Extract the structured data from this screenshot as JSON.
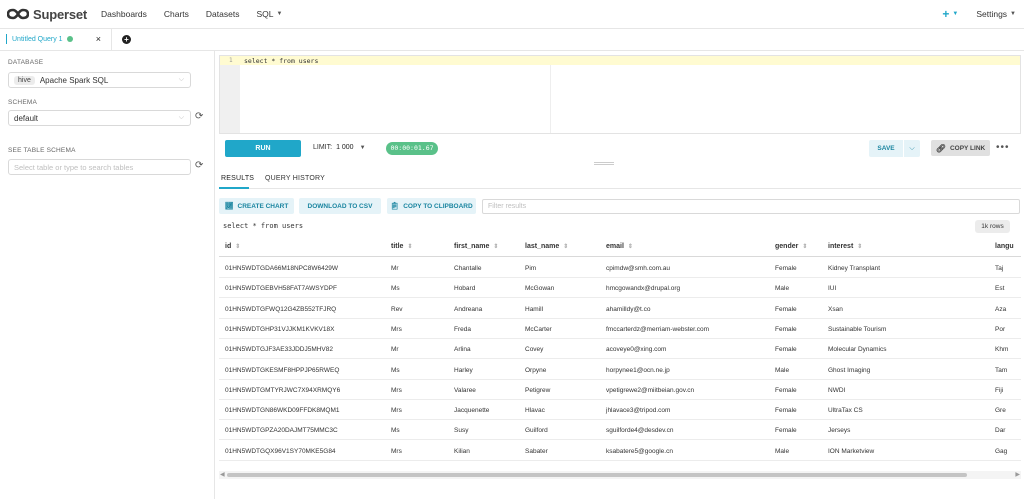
{
  "brand": {
    "name": "Superset"
  },
  "nav": {
    "items": [
      {
        "label": "Dashboards"
      },
      {
        "label": "Charts"
      },
      {
        "label": "Datasets"
      },
      {
        "label": "SQL"
      }
    ],
    "plus": "+",
    "settings": "Settings"
  },
  "tabs": {
    "active_label": "Untitled Query 1",
    "close": "×",
    "add": "+"
  },
  "left": {
    "database_label": "DATABASE",
    "database_tag": "hive",
    "database_value": "Apache Spark SQL",
    "schema_label": "SCHEMA",
    "schema_value": "default",
    "table_label": "SEE TABLE SCHEMA",
    "table_placeholder": "Select table or type to search tables"
  },
  "editor": {
    "line_number": "1",
    "code": "select * from users"
  },
  "toolbar": {
    "run": "RUN",
    "limit_label": "LIMIT:",
    "limit_value": "1 000",
    "timer": "00:00:01.67",
    "save": "SAVE",
    "copy_link": "COPY LINK"
  },
  "results": {
    "tab_results": "RESULTS",
    "tab_history": "QUERY HISTORY",
    "create_chart": "CREATE CHART",
    "download_csv": "DOWNLOAD TO CSV",
    "copy_clipboard": "COPY TO CLIPBOARD",
    "filter_placeholder": "Filter results",
    "query_text": "select * from users",
    "rows_badge": "1k rows",
    "columns": [
      "id",
      "title",
      "first_name",
      "last_name",
      "email",
      "gender",
      "interest",
      "langu"
    ],
    "rows": [
      [
        "01HN5WDTGDA66M18NPC8W6429W",
        "Mr",
        "Chantalle",
        "Pim",
        "cpimdw@smh.com.au",
        "Female",
        "Kidney Transplant",
        "Taj"
      ],
      [
        "01HN5WDTGEBVH58FAT7AWSYDPF",
        "Ms",
        "Hobard",
        "McGowan",
        "hmcgowandx@drupal.org",
        "Male",
        "IUI",
        "Est"
      ],
      [
        "01HN5WDTGFWQ12G4ZB552TFJRQ",
        "Rev",
        "Andreana",
        "Hamill",
        "ahamilldy@t.co",
        "Female",
        "Xsan",
        "Aza"
      ],
      [
        "01HN5WDTGHP31VJJKM1KVKV18X",
        "Mrs",
        "Freda",
        "McCarter",
        "fmccarterdz@merriam-webster.com",
        "Female",
        "Sustainable Tourism",
        "Por"
      ],
      [
        "01HN5WDTGJF3AE33JDDJ5MHV82",
        "Mr",
        "Arlina",
        "Covey",
        "acoveye0@xing.com",
        "Female",
        "Molecular Dynamics",
        "Khm"
      ],
      [
        "01HN5WDTGKESMF8HPPJP65RWEQ",
        "Ms",
        "Harley",
        "Orpyne",
        "horpynee1@ocn.ne.jp",
        "Male",
        "Ghost Imaging",
        "Tam"
      ],
      [
        "01HN5WDTGMTYRJWC7X94XRMQY6",
        "Mrs",
        "Valaree",
        "Petigrew",
        "vpetigrewe2@miitbeian.gov.cn",
        "Female",
        "NWDI",
        "Fiji"
      ],
      [
        "01HN5WDTGN86WKD09FFDK8MQM1",
        "Mrs",
        "Jacquenette",
        "Hlavac",
        "jhlavace3@tripod.com",
        "Female",
        "UltraTax CS",
        "Gre"
      ],
      [
        "01HN5WDTGPZA20DAJMT75MMC3C",
        "Ms",
        "Susy",
        "Guilford",
        "sguilforde4@desdev.cn",
        "Female",
        "Jerseys",
        "Dar"
      ],
      [
        "01HN5WDTGQX96V1SY70MKE5G84",
        "Mrs",
        "Kilian",
        "Sabater",
        "ksabatere5@google.cn",
        "Male",
        "ION Marketview",
        "Gag"
      ]
    ]
  }
}
